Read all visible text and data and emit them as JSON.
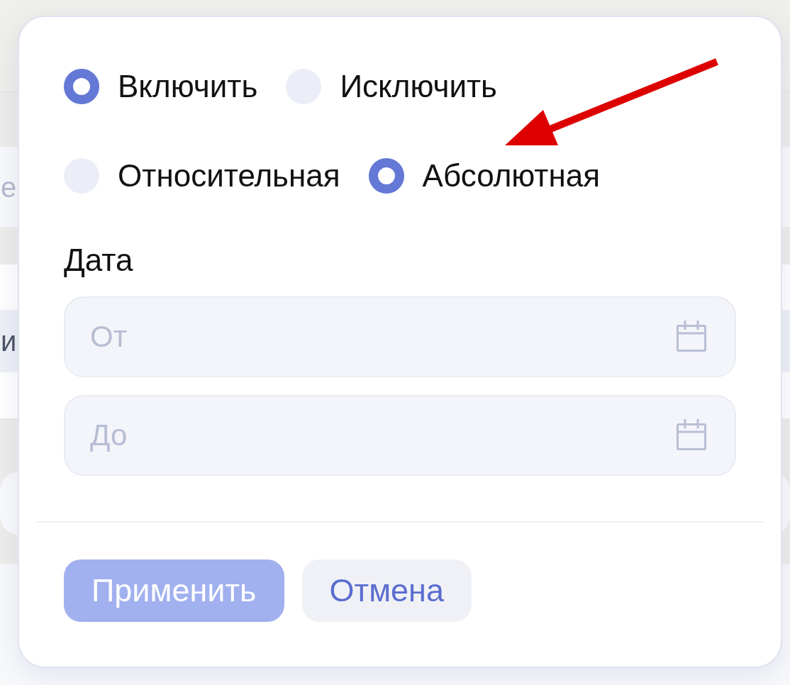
{
  "background": {
    "fragments": [
      {
        "kind": "placeholder",
        "text": "е"
      },
      {
        "kind": "label",
        "text": "и"
      }
    ]
  },
  "popover": {
    "include_mode": [
      {
        "label": "Включить",
        "selected": true
      },
      {
        "label": "Исключить",
        "selected": false
      }
    ],
    "date_type": [
      {
        "label": "Относительная",
        "selected": false
      },
      {
        "label": "Абсолютная",
        "selected": true
      }
    ],
    "date_label": "Дата",
    "date_fields": [
      {
        "placeholder": "От"
      },
      {
        "placeholder": "До"
      }
    ],
    "buttons": [
      {
        "label": "Применить",
        "kind": "primary",
        "disabled": true
      },
      {
        "label": "Отмена",
        "kind": "secondary",
        "disabled": false
      }
    ]
  },
  "annotation": {
    "kind": "arrow"
  }
}
